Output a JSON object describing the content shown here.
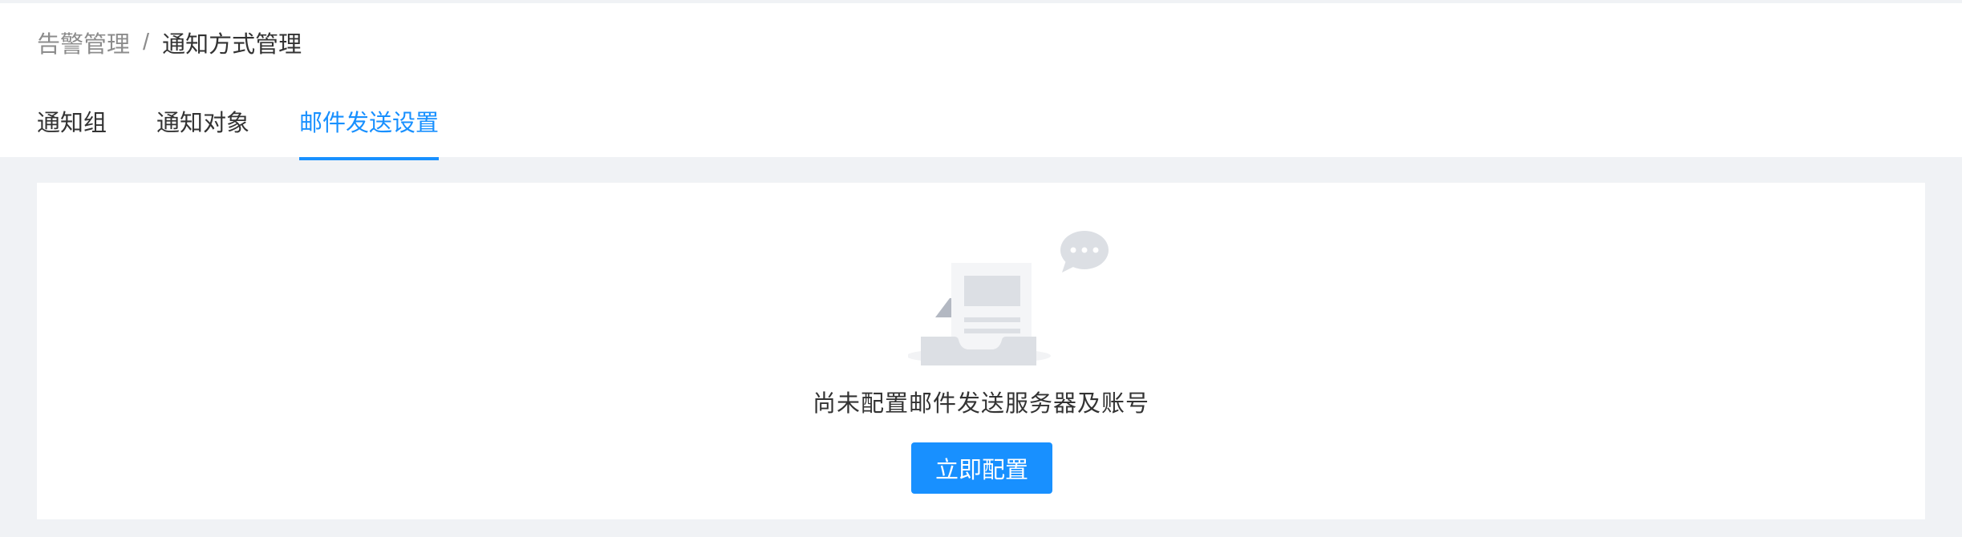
{
  "breadcrumb": {
    "parent": "告警管理",
    "separator": "/",
    "current": "通知方式管理"
  },
  "tabs": [
    {
      "label": "通知组",
      "active": false
    },
    {
      "label": "通知对象",
      "active": false
    },
    {
      "label": "邮件发送设置",
      "active": true
    }
  ],
  "empty_state": {
    "icon": "empty-inbox-icon",
    "message": "尚未配置邮件发送服务器及账号",
    "button_label": "立即配置"
  },
  "colors": {
    "accent": "#1890ff",
    "page_background": "#f0f2f5",
    "card_background": "#ffffff",
    "text": "#333333",
    "muted_text": "#8c8c8c"
  }
}
